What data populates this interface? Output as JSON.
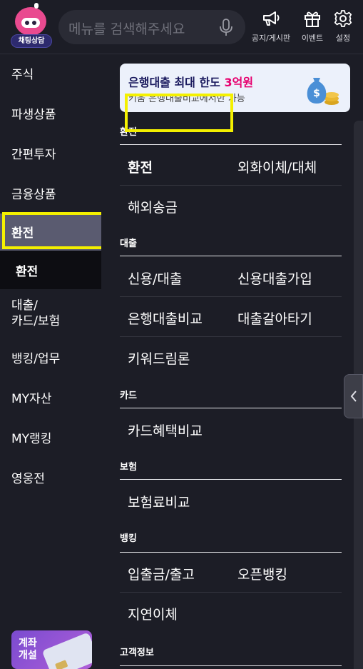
{
  "header": {
    "chatbot_label": "채팅상담",
    "search_placeholder": "메뉴를 검색해주세요",
    "buttons": [
      {
        "label": "공지/게시판",
        "icon": "megaphone-icon"
      },
      {
        "label": "이벤트",
        "icon": "gift-icon"
      },
      {
        "label": "설정",
        "icon": "gear-icon"
      }
    ]
  },
  "sidebar": {
    "items": [
      {
        "label": "주식"
      },
      {
        "label": "파생상품"
      },
      {
        "label": "간편투자"
      },
      {
        "label": "금융상품"
      },
      {
        "label": "환전",
        "active": true
      },
      {
        "label": "대출/\n카드/보험"
      },
      {
        "label": "뱅킹/업무"
      },
      {
        "label": "MY자산"
      },
      {
        "label": "MY랭킹"
      },
      {
        "label": "영웅전"
      }
    ],
    "sub_item": "환전",
    "open_account_label": "계좌\n개설"
  },
  "banner": {
    "line1_prefix": "은행대출 최대 한도 ",
    "line1_accent": "3억원",
    "line2": "키움 은행대출비교에서만 가능"
  },
  "sections": [
    {
      "title": "환전",
      "rows": [
        [
          "환전",
          "외화이체/대체"
        ],
        [
          "해외송금"
        ]
      ]
    },
    {
      "title": "대출",
      "rows": [
        [
          "신용/대출",
          "신용대출가입"
        ],
        [
          "은행대출비교",
          "대출갈아타기"
        ],
        [
          "키워드림론"
        ]
      ]
    },
    {
      "title": "카드",
      "rows": [
        [
          "카드혜택비교"
        ]
      ]
    },
    {
      "title": "보험",
      "rows": [
        [
          "보험료비교"
        ]
      ]
    },
    {
      "title": "뱅킹",
      "rows": [
        [
          "입출금/출고",
          "오픈뱅킹"
        ],
        [
          "지연이체"
        ]
      ]
    },
    {
      "title": "고객정보",
      "rows": []
    }
  ],
  "colors": {
    "background": "#1c1d26",
    "active_nav": "#5a5b70",
    "highlight": "#f4f000",
    "banner_accent": "#e6006e"
  }
}
